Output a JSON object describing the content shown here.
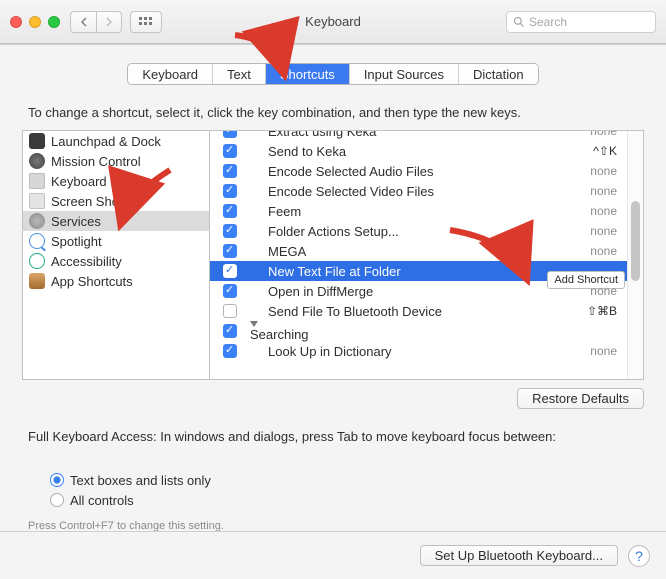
{
  "window": {
    "title": "Keyboard",
    "search_placeholder": "Search"
  },
  "tabs": [
    "Keyboard",
    "Text",
    "Shortcuts",
    "Input Sources",
    "Dictation"
  ],
  "active_tab": 2,
  "description": "To change a shortcut, select it, click the key combination, and then type the new keys.",
  "sidebar": {
    "items": [
      "Launchpad & Dock",
      "Mission Control",
      "Keyboard",
      "Screen Shots",
      "Services",
      "Spotlight",
      "Accessibility",
      "App Shortcuts"
    ],
    "selected": 4
  },
  "rows": [
    {
      "checked": true,
      "label": "Extract using Keka",
      "shortcut": "none",
      "kind": "item",
      "partial": true
    },
    {
      "checked": true,
      "label": "Send to Keka",
      "shortcut": "^⇧K",
      "kind": "item"
    },
    {
      "checked": true,
      "label": "Encode Selected Audio Files",
      "shortcut": "none",
      "kind": "item"
    },
    {
      "checked": true,
      "label": "Encode Selected Video Files",
      "shortcut": "none",
      "kind": "item"
    },
    {
      "checked": true,
      "label": "Feem",
      "shortcut": "none",
      "kind": "item"
    },
    {
      "checked": true,
      "label": "Folder Actions Setup...",
      "shortcut": "none",
      "kind": "item"
    },
    {
      "checked": true,
      "label": "MEGA",
      "shortcut": "none",
      "kind": "item"
    },
    {
      "checked": true,
      "label": "New Text File at Folder",
      "shortcut": "",
      "kind": "item",
      "selected": true,
      "addShortcut": true
    },
    {
      "checked": true,
      "label": "Open in DiffMerge",
      "shortcut": "none",
      "kind": "item"
    },
    {
      "checked": false,
      "label": "Send File To Bluetooth Device",
      "shortcut": "⇧⌘B",
      "kind": "item"
    },
    {
      "checked": true,
      "label": "Searching",
      "shortcut": "",
      "kind": "group"
    },
    {
      "checked": true,
      "label": "Look Up in Dictionary",
      "shortcut": "none",
      "kind": "item"
    }
  ],
  "add_shortcut_label": "Add Shortcut",
  "restore_label": "Restore Defaults",
  "fka": {
    "text": "Full Keyboard Access: In windows and dialogs, press Tab to move keyboard focus between:",
    "options": [
      "Text boxes and lists only",
      "All controls"
    ],
    "selected": 0,
    "hint": "Press Control+F7 to change this setting."
  },
  "footer": {
    "bluetooth": "Set Up Bluetooth Keyboard..."
  }
}
